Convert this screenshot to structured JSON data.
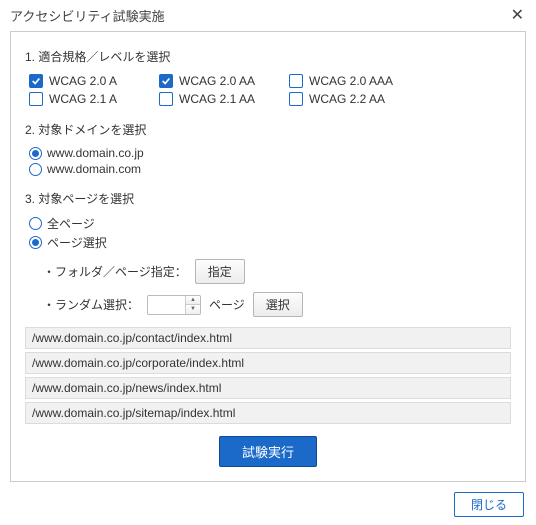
{
  "title": "アクセシビリティ試験実施",
  "sections": {
    "s1": "1. 適合規格／レベルを選択",
    "s2": "2. 対象ドメインを選択",
    "s3": "3. 対象ページを選択"
  },
  "standards": [
    {
      "label": "WCAG 2.0 A",
      "checked": true
    },
    {
      "label": "WCAG 2.0 AA",
      "checked": true
    },
    {
      "label": "WCAG 2.0 AAA",
      "checked": false
    },
    {
      "label": "WCAG 2.1 A",
      "checked": false
    },
    {
      "label": "WCAG 2.1 AA",
      "checked": false
    },
    {
      "label": "WCAG 2.2 AA",
      "checked": false
    }
  ],
  "domains": [
    {
      "label": "www.domain.co.jp",
      "selected": true
    },
    {
      "label": "www.domain.com",
      "selected": false
    }
  ],
  "pages": {
    "all_label": "全ページ",
    "select_label": "ページ選択",
    "selected": "select",
    "folder_label": "フォルダ／ページ指定：",
    "folder_button": "指定",
    "random_label": "ランダム選択：",
    "random_value": "",
    "random_unit": "ページ",
    "random_button": "選択"
  },
  "paths": [
    "/www.domain.co.jp/contact/index.html",
    "/www.domain.co.jp/corporate/index.html",
    "/www.domain.co.jp/news/index.html",
    "/www.domain.co.jp/sitemap/index.html"
  ],
  "run_label": "試験実行",
  "close_label": "閉じる"
}
